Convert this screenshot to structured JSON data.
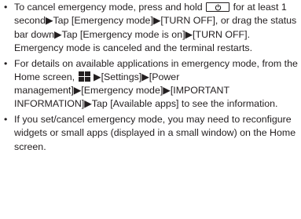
{
  "bullet_symbol": "•",
  "items": [
    {
      "before_key": "To cancel emergency mode, press and hold",
      "key_icon": "power-icon",
      "after_key": "for at least 1 second▶Tap [Emergency mode]▶[TURN OFF], or drag the status bar down▶Tap [Emergency mode is on]▶[TURN OFF]. Emergency mode is canceled and the terminal restarts."
    },
    {
      "before_icon": "For details on available applications in emergency mode, from the Home screen,",
      "icon": "apps-grid-icon",
      "after_icon": "▶[Settings]▶[Power management]▶[Emergency mode]▶[IMPORTANT INFORMATION]▶Tap [Available apps] to see the information."
    },
    {
      "text": "If you set/cancel emergency mode, you may need to reconfigure widgets or small apps (displayed in a small window) on the Home screen."
    }
  ]
}
